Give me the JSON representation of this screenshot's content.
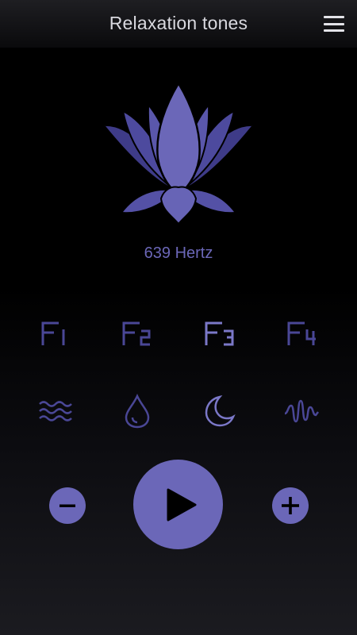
{
  "header": {
    "title": "Relaxation tones",
    "menu_icon": "hamburger-menu-icon"
  },
  "hero": {
    "icon": "lotus-icon",
    "frequency_label": "639 Hertz"
  },
  "frequencies": [
    {
      "label": "F",
      "subscript": "1",
      "selected": false
    },
    {
      "label": "F",
      "subscript": "2",
      "selected": false
    },
    {
      "label": "F",
      "subscript": "3",
      "selected": true
    },
    {
      "label": "F",
      "subscript": "4",
      "selected": false
    }
  ],
  "sounds": [
    {
      "icon": "waves-icon",
      "selected": false
    },
    {
      "icon": "water-drop-icon",
      "selected": false
    },
    {
      "icon": "moon-icon",
      "selected": true
    },
    {
      "icon": "sound-wave-icon",
      "selected": false
    }
  ],
  "controls": {
    "minus_icon": "minus-icon",
    "play_icon": "play-icon",
    "plus_icon": "plus-icon"
  },
  "colors": {
    "accent": "#6b67b8",
    "accent_dim": "#4a4796",
    "selected": "#7b78c8",
    "text": "#d9d9df"
  }
}
